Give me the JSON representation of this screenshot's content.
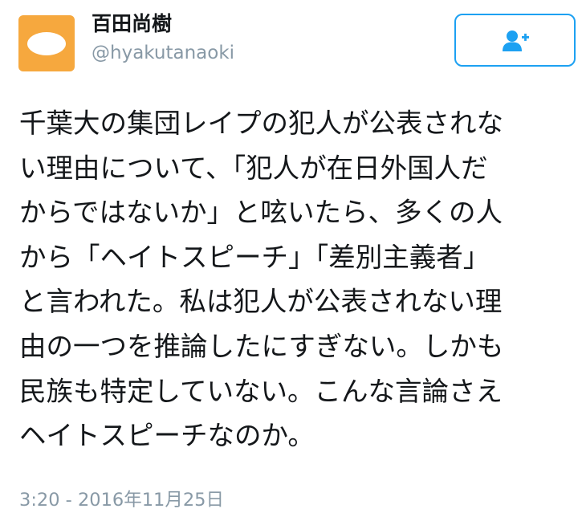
{
  "author": {
    "display_name": "百田尚樹",
    "username": "@hyakutanaoki",
    "avatar_color": "#f6a83e"
  },
  "follow_button": {
    "icon": "add-user-icon",
    "accent_color": "#1da1f2"
  },
  "tweet": {
    "lines": [
      "千葉大の集団レイプの犯人が公表されな",
      "い理由について、「犯人が在日外国人だ",
      "からではないか」と呟いたら、多くの人",
      "から「ヘイトスピーチ」「差別主義者」",
      "と言われた。私は犯人が公表されない理",
      "由の一つを推論したにすぎない。しかも",
      "民族も特定していない。こんな言論さえ",
      "ヘイトスピーチなのか。"
    ],
    "timestamp": "3:20 - 2016年11月25日"
  }
}
